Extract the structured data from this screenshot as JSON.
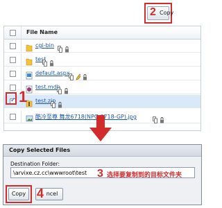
{
  "toolbar": {
    "copy_label": "Copy",
    "step_number": "2"
  },
  "file_table": {
    "header": "File Name",
    "rows": [
      {
        "name": "cgi-bin",
        "icon": "folder-icon",
        "checked": false,
        "actions": [
          "copy-icon",
          "lock-icon"
        ]
      },
      {
        "name": "test",
        "icon": "folder-icon",
        "checked": false,
        "actions": [
          "copy-icon",
          "lock-icon"
        ]
      },
      {
        "name": "default.aspx",
        "icon": "aspx-file-icon",
        "checked": false,
        "actions": [
          "copy-icon",
          "edit-icon",
          "lock-icon"
        ]
      },
      {
        "name": "test.mdb",
        "icon": "database-file-icon",
        "checked": false,
        "actions": [
          "copy-icon",
          "lock-icon"
        ]
      },
      {
        "name": "test.zip",
        "icon": "zip-file-icon",
        "checked": true,
        "actions": [
          "copy-icon",
          "lock-icon"
        ]
      },
      {
        "name": "酷冷至尊 舞龙6718(NPC-6718-GP).jpg",
        "icon": "image-file-icon",
        "checked": false,
        "actions": [
          "copy-icon",
          "lock-icon"
        ]
      }
    ],
    "step_number": "1"
  },
  "dialog": {
    "title": "Copy Selected Files",
    "destination_label": "Destination Folder:",
    "destination_value": "\\arvixe.cz.cc\\wwwroot\\test",
    "step3_number": "3",
    "step3_note": "选择要复制到的目标文件夹",
    "copy_label": "Copy",
    "cancel_label": "ncel",
    "step4_number": "4"
  },
  "colors": {
    "highlight": "#d12b2b",
    "link": "#1a56b0",
    "selected_row": "#d9e9fa"
  }
}
